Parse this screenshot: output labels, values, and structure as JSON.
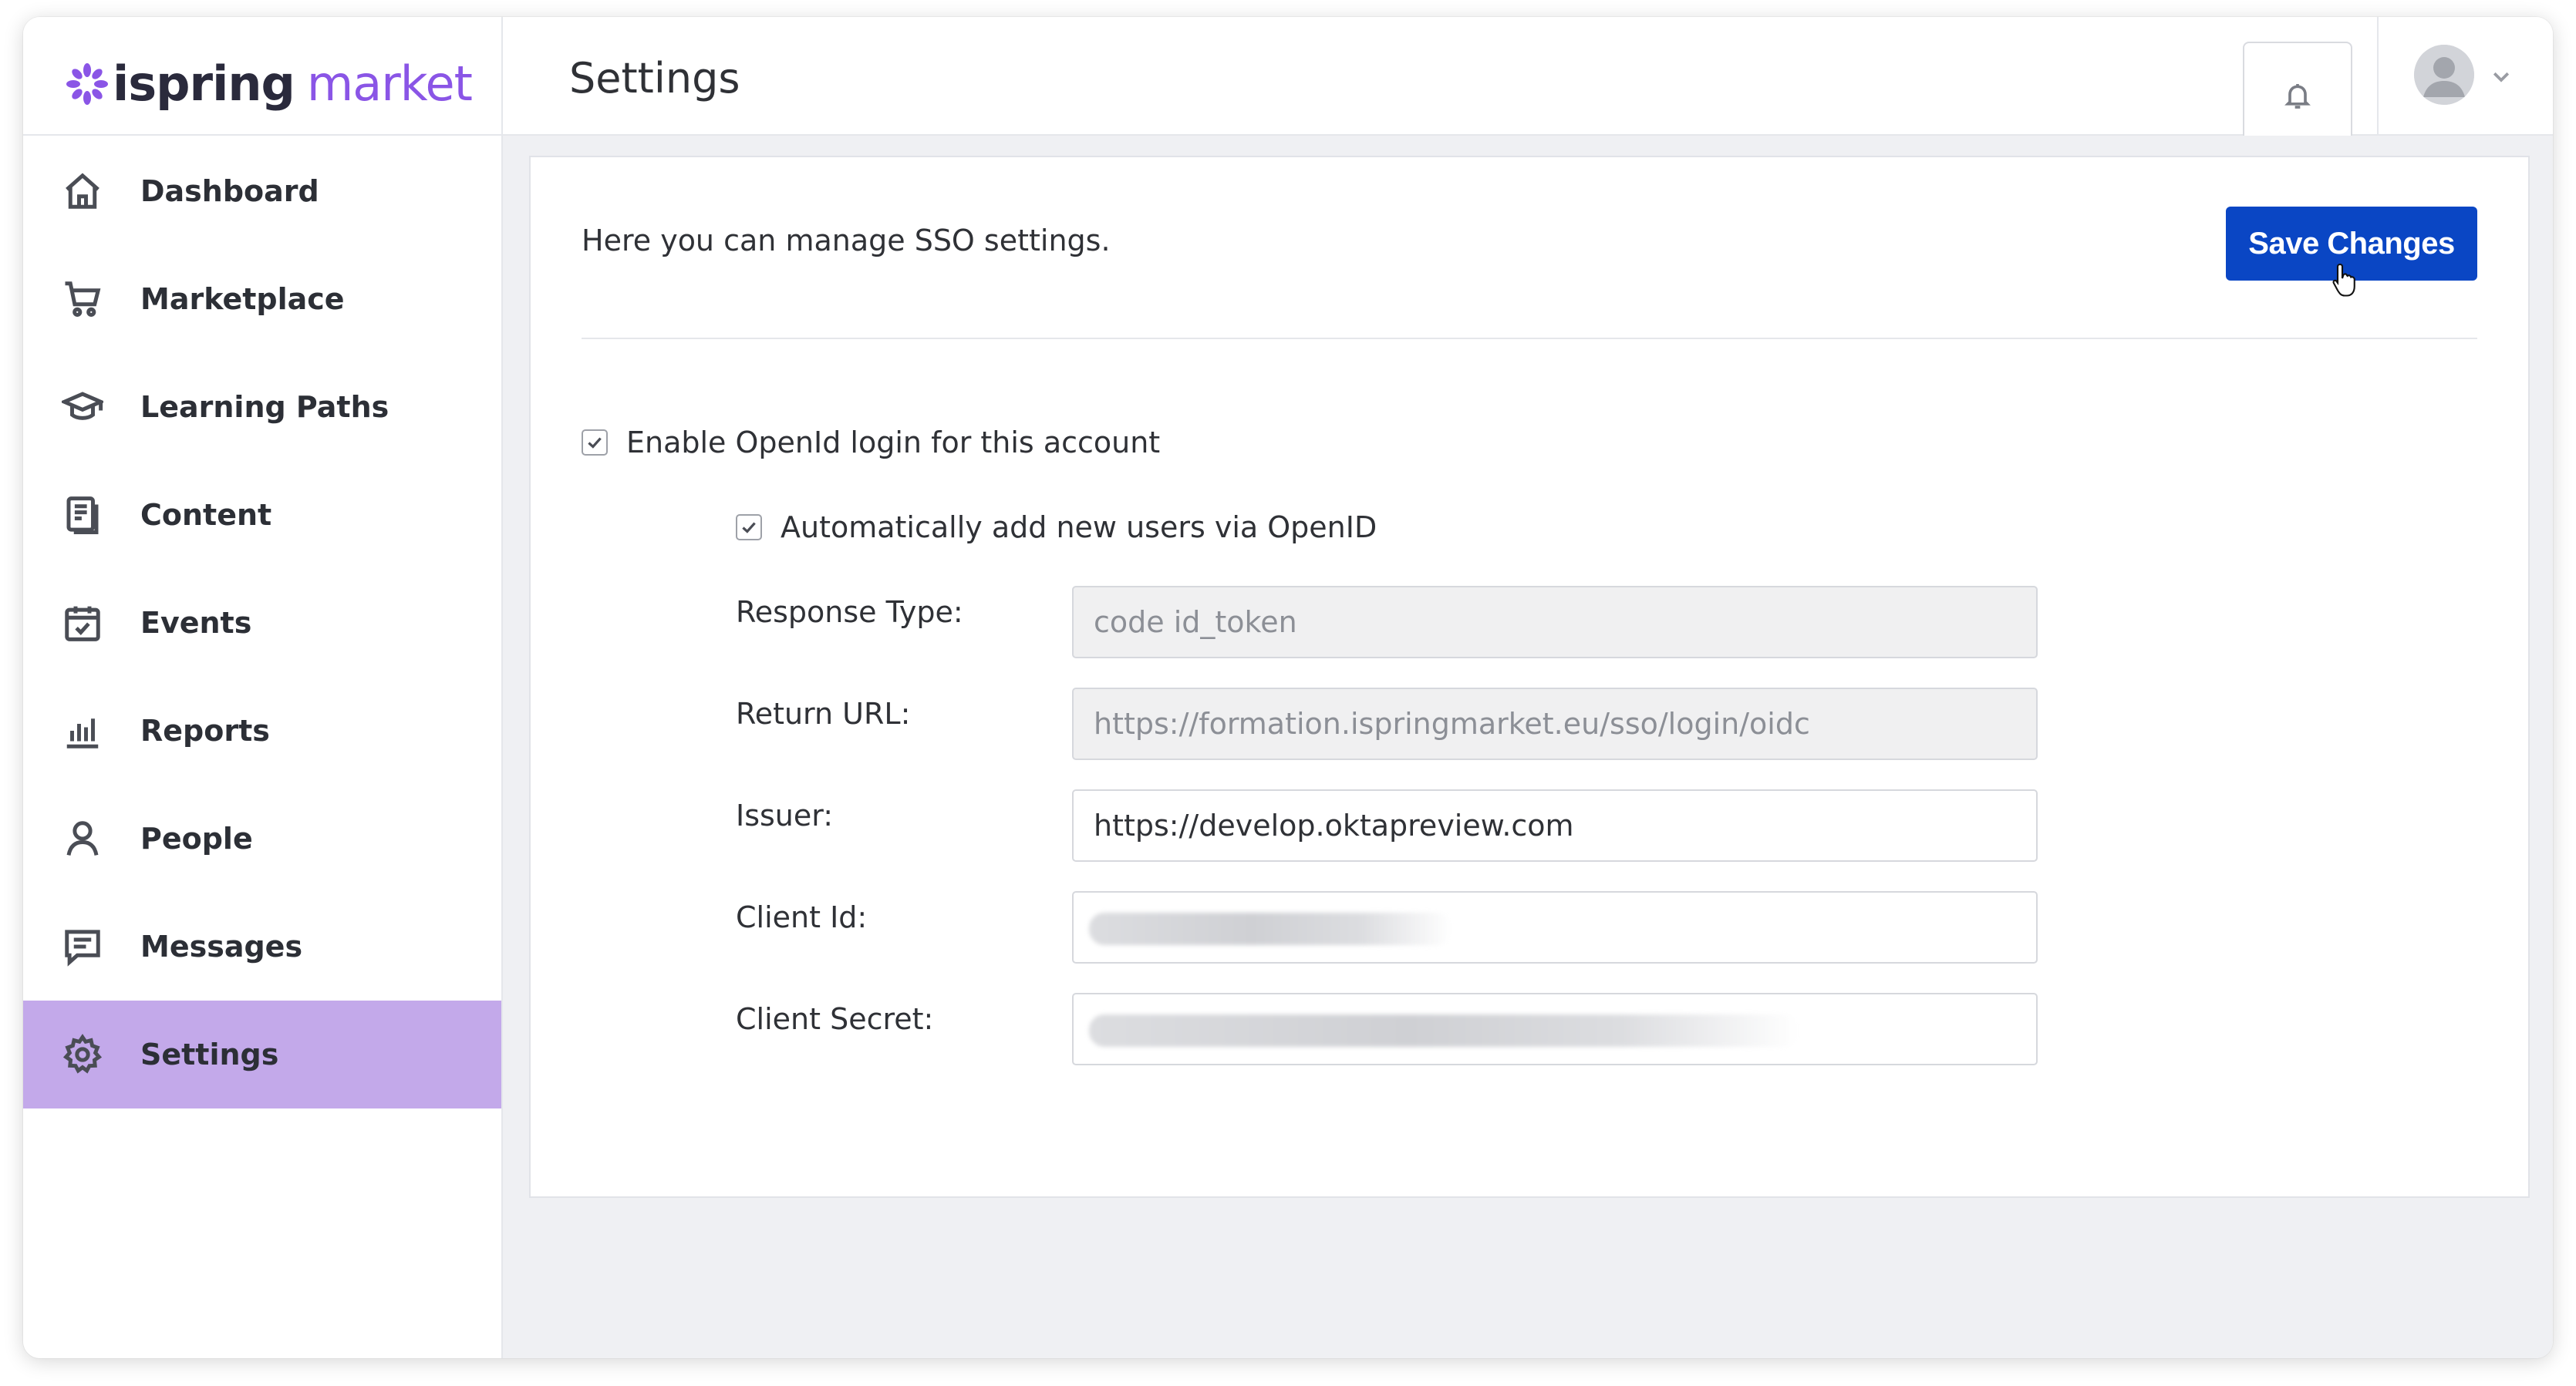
{
  "brand": {
    "name_part1": "ispring",
    "name_part2": "market"
  },
  "header": {
    "title": "Settings"
  },
  "sidebar": {
    "items": [
      {
        "label": "Dashboard",
        "icon": "home-icon",
        "active": false
      },
      {
        "label": "Marketplace",
        "icon": "cart-icon",
        "active": false
      },
      {
        "label": "Learning Paths",
        "icon": "graduation-cap-icon",
        "active": false
      },
      {
        "label": "Content",
        "icon": "document-icon",
        "active": false
      },
      {
        "label": "Events",
        "icon": "calendar-check-icon",
        "active": false
      },
      {
        "label": "Reports",
        "icon": "bar-chart-icon",
        "active": false
      },
      {
        "label": "People",
        "icon": "person-icon",
        "active": false
      },
      {
        "label": "Messages",
        "icon": "message-icon",
        "active": false
      },
      {
        "label": "Settings",
        "icon": "gear-icon",
        "active": true
      }
    ]
  },
  "sso": {
    "intro": "Here you can manage SSO settings.",
    "save_label": "Save Changes",
    "enable_openid": {
      "label": "Enable OpenId login for this account",
      "checked": true
    },
    "auto_add": {
      "label": "Automatically add new users via OpenID",
      "checked": true
    },
    "fields": {
      "response_type": {
        "label": "Response Type:",
        "value": "code id_token"
      },
      "return_url": {
        "label": "Return URL:",
        "value": "https://formation.ispringmarket.eu/sso/login/oidc"
      },
      "issuer": {
        "label": "Issuer:",
        "value": "https://develop.oktapreview.com"
      },
      "client_id": {
        "label": "Client Id:"
      },
      "client_secret": {
        "label": "Client Secret:"
      }
    }
  },
  "colors": {
    "accent": "#0a46c4",
    "active_nav": "#c3a9ea",
    "brand_purple": "#8a55e6"
  }
}
